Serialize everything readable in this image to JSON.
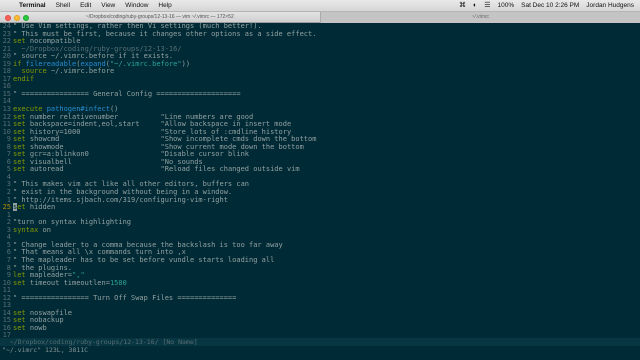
{
  "menubar": {
    "apple": "",
    "items": [
      "Terminal",
      "Shell",
      "Edit",
      "View",
      "Window",
      "Help"
    ],
    "status_right": [
      "⌘",
      "◐",
      "☰",
      "100%",
      "Sat Dec 10  2:26 PM",
      "Jordan Hudgens"
    ]
  },
  "window": {
    "tab_active": "~/Dropbox/coding/ruby-groups/12-13-16 — vim ~/.vimrc — 172×52",
    "tab_inactive": "~/.vimrc"
  },
  "editor": {
    "lines": [
      {
        "n": "24",
        "segs": [
          [
            "c-comment",
            "\" Use Vim settings, rather then Vi settings (much better!).  "
          ]
        ]
      },
      {
        "n": "23",
        "segs": [
          [
            "c-comment",
            "\" This must be first, because it changes other options as a side effect."
          ]
        ]
      },
      {
        "n": "22",
        "segs": [
          [
            "c-kw",
            "set "
          ],
          [
            "c-plain",
            "nocompatible"
          ]
        ]
      },
      {
        "n": "21",
        "segs": [
          [
            "c-dim",
            "  ~/Dropbox/coding/ruby-groups/12-13-16/"
          ]
        ]
      },
      {
        "n": "20",
        "segs": [
          [
            "c-comment",
            "\" source ~/.vimrc.before if it exists."
          ]
        ]
      },
      {
        "n": "19",
        "segs": [
          [
            "c-kw",
            "if "
          ],
          [
            "c-func",
            "filereadable"
          ],
          [
            "c-plain",
            "("
          ],
          [
            "c-func",
            "expand"
          ],
          [
            "c-plain",
            "("
          ],
          [
            "c-str",
            "\"~/.vimrc.before\""
          ],
          [
            "c-plain",
            "))"
          ]
        ]
      },
      {
        "n": "18",
        "segs": [
          [
            "c-plain",
            "  "
          ],
          [
            "c-kw",
            "source "
          ],
          [
            "c-plain",
            "~/.vimrc.before"
          ]
        ]
      },
      {
        "n": "17",
        "segs": [
          [
            "c-kw",
            "endif"
          ]
        ]
      },
      {
        "n": "16",
        "segs": [
          [
            "c-plain",
            ""
          ]
        ]
      },
      {
        "n": "15",
        "segs": [
          [
            "c-comment",
            "\" ================ General Config ===================="
          ]
        ]
      },
      {
        "n": "14",
        "segs": [
          [
            "c-plain",
            ""
          ]
        ]
      },
      {
        "n": "13",
        "segs": [
          [
            "c-kw",
            "execute "
          ],
          [
            "c-func",
            "pathogen#infect"
          ],
          [
            "c-plain",
            "()"
          ]
        ]
      },
      {
        "n": "12",
        "segs": [
          [
            "c-kw",
            "set "
          ],
          [
            "c-plain",
            "number relativenumber          "
          ],
          [
            "c-comment",
            "\"Line numbers are good"
          ]
        ]
      },
      {
        "n": "11",
        "segs": [
          [
            "c-kw",
            "set "
          ],
          [
            "c-plain",
            "backspace=indent,eol,start     "
          ],
          [
            "c-comment",
            "\"Allow backspace in insert mode"
          ]
        ]
      },
      {
        "n": "10",
        "segs": [
          [
            "c-kw",
            "set "
          ],
          [
            "c-plain",
            "history=1000                   "
          ],
          [
            "c-comment",
            "\"Store lots of :cmdline history"
          ]
        ]
      },
      {
        "n": "9",
        "segs": [
          [
            "c-kw",
            "set "
          ],
          [
            "c-plain",
            "showcmd                        "
          ],
          [
            "c-comment",
            "\"Show incomplete cmds down the bottom"
          ]
        ]
      },
      {
        "n": "8",
        "segs": [
          [
            "c-kw",
            "set "
          ],
          [
            "c-plain",
            "showmode                       "
          ],
          [
            "c-comment",
            "\"Show current mode down the bottom"
          ]
        ]
      },
      {
        "n": "7",
        "segs": [
          [
            "c-kw",
            "set "
          ],
          [
            "c-plain",
            "gcr=a:blinkon0                 "
          ],
          [
            "c-comment",
            "\"Disable cursor blink"
          ]
        ]
      },
      {
        "n": "6",
        "segs": [
          [
            "c-kw",
            "set "
          ],
          [
            "c-plain",
            "visualbell                     "
          ],
          [
            "c-comment",
            "\"No sounds"
          ]
        ]
      },
      {
        "n": "5",
        "segs": [
          [
            "c-kw",
            "set "
          ],
          [
            "c-plain",
            "autoread                       "
          ],
          [
            "c-comment",
            "\"Reload files changed outside vim"
          ]
        ]
      },
      {
        "n": "4",
        "segs": [
          [
            "c-plain",
            ""
          ]
        ]
      },
      {
        "n": "3",
        "segs": [
          [
            "c-comment",
            "\" This makes vim act like all other editors, buffers can"
          ]
        ]
      },
      {
        "n": "2",
        "segs": [
          [
            "c-comment",
            "\" exist in the background without being in a window."
          ]
        ]
      },
      {
        "n": "1",
        "segs": [
          [
            "c-comment",
            "\" http://items.sjbach.com/319/configuring-vim-right"
          ]
        ]
      },
      {
        "n": "25",
        "cur": true,
        "segs": [
          [
            "c-cursor",
            "s"
          ],
          [
            "c-kw",
            "et "
          ],
          [
            "c-plain",
            "hidden"
          ]
        ]
      },
      {
        "n": "1",
        "segs": [
          [
            "c-plain",
            ""
          ]
        ]
      },
      {
        "n": "2",
        "segs": [
          [
            "c-comment",
            "\"turn on syntax highlighting"
          ]
        ]
      },
      {
        "n": "3",
        "segs": [
          [
            "c-kw",
            "syntax "
          ],
          [
            "c-plain",
            "on"
          ]
        ]
      },
      {
        "n": "4",
        "segs": [
          [
            "c-plain",
            ""
          ]
        ]
      },
      {
        "n": "5",
        "segs": [
          [
            "c-comment",
            "\" Change leader to a comma because the backslash is too far away"
          ]
        ]
      },
      {
        "n": "6",
        "segs": [
          [
            "c-comment",
            "\" That means all \\x commands turn into ,x"
          ]
        ]
      },
      {
        "n": "7",
        "segs": [
          [
            "c-comment",
            "\" The mapleader has to be set before vundle starts loading all"
          ]
        ]
      },
      {
        "n": "8",
        "segs": [
          [
            "c-comment",
            "\" the plugins."
          ]
        ]
      },
      {
        "n": "9",
        "segs": [
          [
            "c-kw",
            "let "
          ],
          [
            "c-plain",
            "mapleader="
          ],
          [
            "c-str",
            "\",\""
          ]
        ]
      },
      {
        "n": "10",
        "segs": [
          [
            "c-kw",
            "set "
          ],
          [
            "c-plain",
            "timeout timeoutlen="
          ],
          [
            "c-num",
            "1500"
          ]
        ]
      },
      {
        "n": "11",
        "segs": [
          [
            "c-plain",
            ""
          ]
        ]
      },
      {
        "n": "12",
        "segs": [
          [
            "c-comment",
            "\" ================ Turn Off Swap Files =============="
          ]
        ]
      },
      {
        "n": "13",
        "segs": [
          [
            "c-plain",
            ""
          ]
        ]
      },
      {
        "n": "14",
        "segs": [
          [
            "c-kw",
            "set "
          ],
          [
            "c-plain",
            "noswapfile"
          ]
        ]
      },
      {
        "n": "15",
        "segs": [
          [
            "c-kw",
            "set "
          ],
          [
            "c-plain",
            "nobackup"
          ]
        ]
      },
      {
        "n": "16",
        "segs": [
          [
            "c-kw",
            "set "
          ],
          [
            "c-plain",
            "nowb"
          ]
        ]
      },
      {
        "n": "17",
        "segs": [
          [
            "c-plain",
            ""
          ]
        ]
      }
    ]
  },
  "statusbar": {
    "text": "  ~/Dropbox/coding/ruby-groups/12-13-16/ [No Name]"
  },
  "cmdline": {
    "text": "\"~/.vimrc\" 123L, 3811C"
  },
  "colors": {
    "background": "#002b36",
    "line_number": "#586e75",
    "current_line_number": "#b58900",
    "keyword": "#859900",
    "function": "#268bd2",
    "string": "#2aa198",
    "comment": "#93a1a1"
  }
}
